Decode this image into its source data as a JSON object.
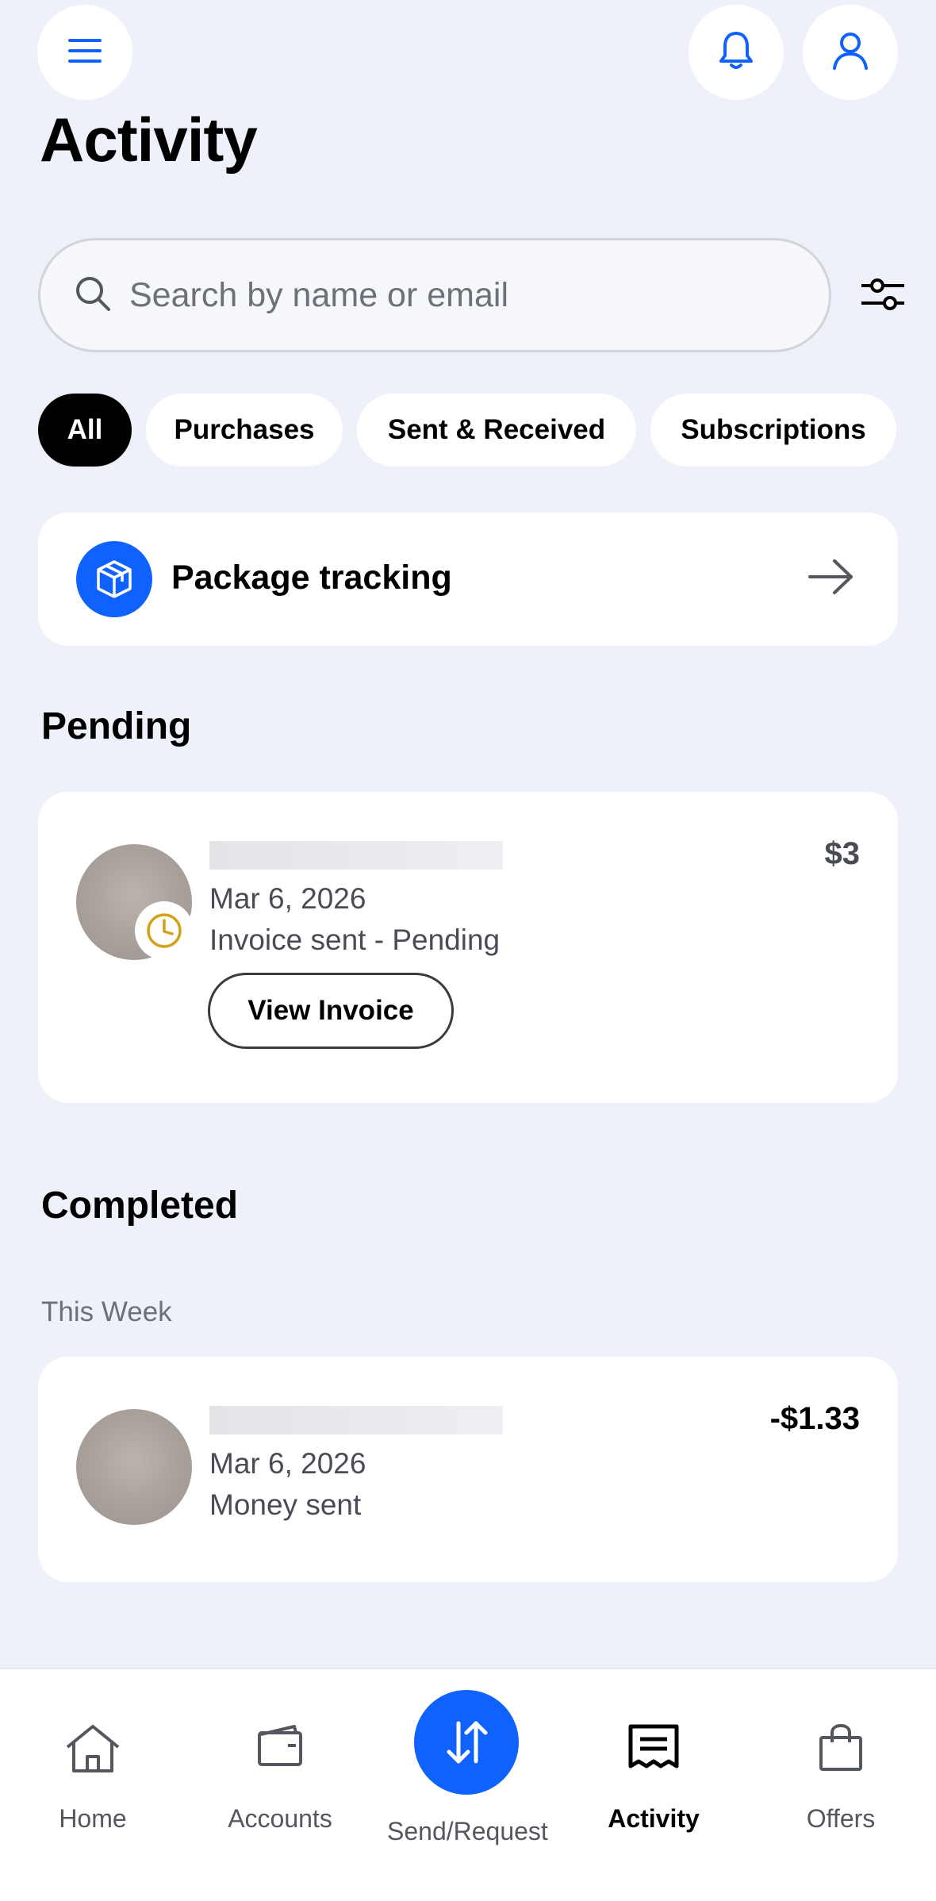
{
  "header": {
    "title": "Activity"
  },
  "search": {
    "placeholder": "Search by name or email"
  },
  "filters": [
    "All",
    "Purchases",
    "Sent & Received",
    "Subscriptions"
  ],
  "package_tracking": {
    "label": "Package tracking"
  },
  "pending": {
    "title": "Pending",
    "transaction": {
      "date": "Mar 6, 2026",
      "status": "Invoice sent - Pending",
      "amount": "$3",
      "button_label": "View Invoice"
    }
  },
  "completed": {
    "title": "Completed",
    "group_label": "This Week",
    "transaction": {
      "date": "Mar 6, 2026",
      "status": "Money sent",
      "amount": "-$1.33"
    }
  },
  "bottom_nav": {
    "items": [
      "Home",
      "Accounts",
      "Send/Request",
      "Activity",
      "Offers"
    ],
    "active": "Activity"
  },
  "colors": {
    "accent": "#0f62fe",
    "background": "#eef1fa",
    "pending_clock": "#d4a017"
  }
}
